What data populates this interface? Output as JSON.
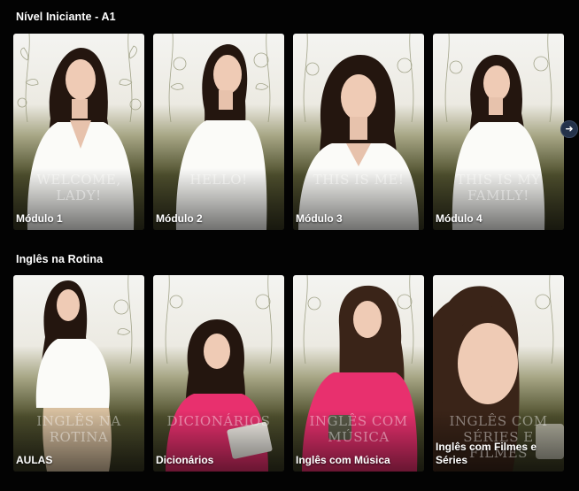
{
  "sections": [
    {
      "title": "Nível Iniciante - A1",
      "cards": [
        {
          "label": "Módulo 1",
          "overlay": "WELCOME, LADY!"
        },
        {
          "label": "Módulo 2",
          "overlay": "HELLO!"
        },
        {
          "label": "Módulo 3",
          "overlay": "THIS IS ME!"
        },
        {
          "label": "Módulo 4",
          "overlay": "THIS IS MY FAMILY!"
        }
      ]
    },
    {
      "title": "Inglês na Rotina",
      "cards": [
        {
          "label": "AULAS",
          "overlay": "INGLÊS NA ROTINA"
        },
        {
          "label": "Dicionários",
          "overlay": "DICIONÁRIOS"
        },
        {
          "label": "Inglês com Música",
          "overlay": "INGLÊS COM MÚSICA"
        },
        {
          "label": "Inglês com Filmes e Séries",
          "overlay": "INGLÊS COM SÉRIES E FILMES"
        }
      ]
    }
  ],
  "next_arrow_icon": "arrow-right-icon",
  "colors": {
    "background": "#030303",
    "arrow_button": "#24324a",
    "shirt_pink": "#e8306e",
    "hair": "#2a1a14"
  }
}
